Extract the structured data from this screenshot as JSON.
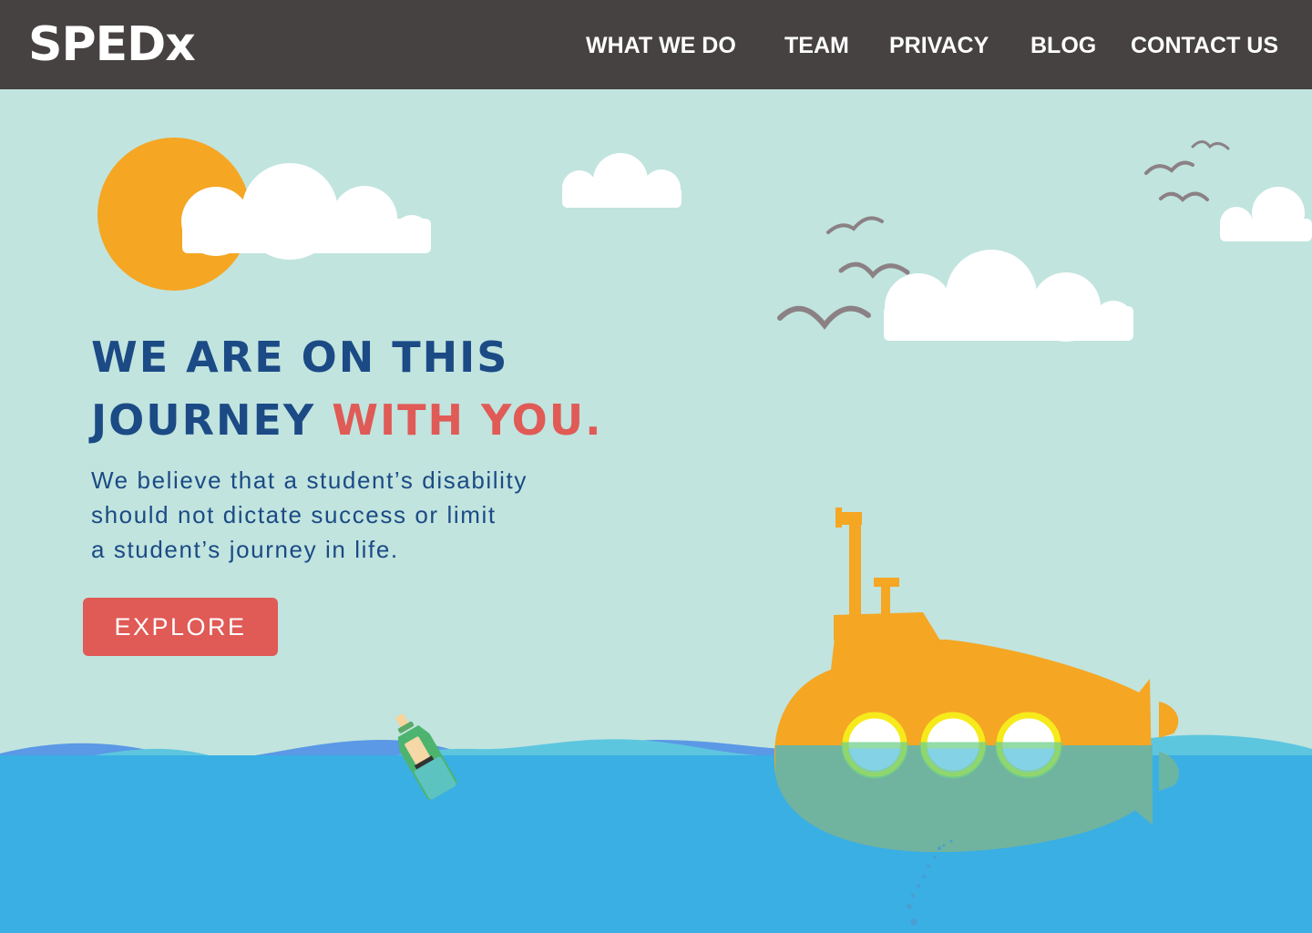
{
  "brand": {
    "logo_text": "SPEDx"
  },
  "nav": {
    "items": [
      {
        "label": "WHAT WE DO"
      },
      {
        "label": "TEAM"
      },
      {
        "label": "PRIVACY"
      },
      {
        "label": "BLOG"
      },
      {
        "label": "CONTACT US"
      }
    ]
  },
  "hero": {
    "headline_line1": "WE ARE ON THIS",
    "headline_line2_start": "JOURNEY",
    "headline_line2_accent": "WITH YOU.",
    "lead_lines": [
      "We believe that a student’s disability",
      "should not dictate success or limit",
      "a student’s journey in life."
    ],
    "cta_label": "EXPLORE"
  },
  "colors": {
    "navbar": "#464241",
    "sky": "#c1e4de",
    "brand_blue": "#1b4a85",
    "accent_red": "#e05a56",
    "sun": "#f5a623",
    "submarine": "#f5a623",
    "sea": "#3aafe4"
  },
  "icons": [
    "sun-icon",
    "cloud-icon",
    "bird-icon",
    "submarine-icon",
    "message-bottle-icon",
    "wave-icon"
  ]
}
